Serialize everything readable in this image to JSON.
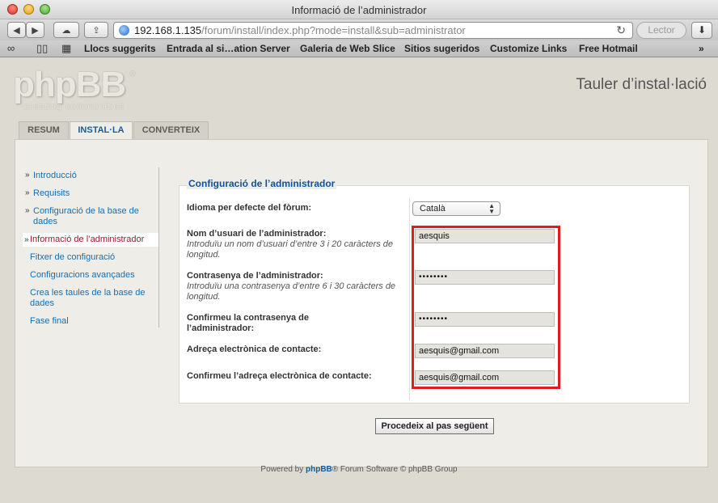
{
  "window": {
    "title": "Informació de l’administrador"
  },
  "toolbar": {
    "url_host": "192.168.1.135",
    "url_path": "/forum/install/index.php?mode=install&sub=administrator",
    "reader_label": "Lector"
  },
  "bookmarks": [
    "Llocs suggerits",
    "Entrada al si…ation Server",
    "Galeria de Web Slice",
    "Sitios sugeridos",
    "Customize Links",
    "Free Hotmail"
  ],
  "header": {
    "logo_text": "phpBB",
    "logo_sub": "creating   communities",
    "site_title": "Tauler d’instal·lació"
  },
  "tabs": [
    "RESUM",
    "INSTAL·LA",
    "CONVERTEIX"
  ],
  "menu": [
    "Introducció",
    "Requisits",
    "Configuració de la base de dades",
    "Informació de l’administrador",
    "Fitxer de configuració",
    "Configuracions avançades",
    "Crea les taules de la base de dades",
    "Fase final"
  ],
  "form": {
    "legend": "Configuració de l’administrador",
    "language_label": "Idioma per defecte del fòrum:",
    "language_value": "Català",
    "username_label": "Nom d’usuari de l’administrador:",
    "username_hint": "Introduïu un nom d’usuari d’entre 3 i 20 caràcters de longitud.",
    "username_value": "aesquis",
    "password_label": "Contrasenya de l’administrador:",
    "password_hint": "Introduïu una contrasenya d’entre 6 i 30 caràcters de longitud.",
    "password_value": "••••••••",
    "password_confirm_label": "Confirmeu la contrasenya de l’administrador:",
    "password_confirm_value": "••••••••",
    "email_label": "Adreça electrònica de contacte:",
    "email_value": "aesquis@gmail.com",
    "email_confirm_label": "Confirmeu l’adreça electrònica de contacte:",
    "email_confirm_value": "aesquis@gmail.com",
    "submit_label": "Procedeix al pas següent"
  },
  "footer": {
    "prefix": "Powered by ",
    "brand": "phpBB",
    "suffix": "® Forum Software © phpBB Group"
  },
  "colors": {
    "link": "#146fb3",
    "current_step": "#9c1a2e",
    "highlight_box": "#e11b22"
  }
}
